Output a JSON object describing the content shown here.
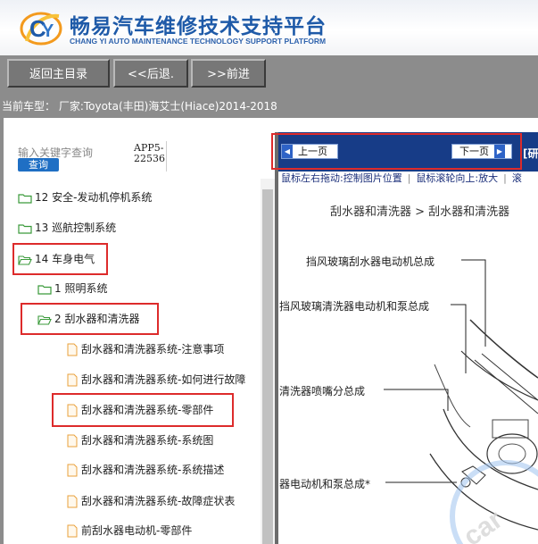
{
  "header": {
    "title": "畅易汽车维修技术支持平台",
    "subtitle": "CHANG YI AUTO MAINTENANCE TECHNOLOGY SUPPORT PLATFORM",
    "logo_icon": "cy-logo-icon"
  },
  "toolbar": {
    "home_label": "返回主目录",
    "back_label": "<<后退.",
    "forward_label": ">>前进"
  },
  "model_bar": {
    "text": "当前车型：  厂家:Toyota(丰田)海艾士(Hiace)2014-2018"
  },
  "search": {
    "placeholder": "输入关键字查询",
    "button_label": "查询",
    "app_code_line1": "APP5-",
    "app_code_line2": "22536"
  },
  "tree": {
    "items": [
      {
        "label": "12 安全-发动机停机系统",
        "icon": "folder-icon"
      },
      {
        "label": "13 巡航控制系统",
        "icon": "folder-icon"
      },
      {
        "label": "14 车身电气",
        "icon": "folder-open-icon"
      },
      {
        "label": "1 照明系统",
        "icon": "folder-icon"
      },
      {
        "label": "2 刮水器和清洗器",
        "icon": "folder-open-icon"
      },
      {
        "label": "刮水器和清洗器系统-注意事项",
        "icon": "document-icon"
      },
      {
        "label": "刮水器和清洗器系统-如何进行故障",
        "icon": "document-icon"
      },
      {
        "label": "刮水器和清洗器系统-零部件",
        "icon": "document-icon"
      },
      {
        "label": "刮水器和清洗器系统-系统图",
        "icon": "document-icon"
      },
      {
        "label": "刮水器和清洗器系统-系统描述",
        "icon": "document-icon"
      },
      {
        "label": "刮水器和清洗器系统-故障症状表",
        "icon": "document-icon"
      },
      {
        "label": "前刮水器电动机-零部件",
        "icon": "document-icon"
      }
    ]
  },
  "viewer": {
    "prev_label": "上一页",
    "next_label": "下一页",
    "side_label": "[研",
    "hint_drag": "鼠标左右拖动:控制图片位置",
    "hint_scroll": "鼠标滚轮向上:放大",
    "hint_more": "滚",
    "diagram": {
      "title": "刮水器和清洗器 > 刮水器和清洗器",
      "labels": [
        "挡风玻璃刮水器电动机总成",
        "挡风玻璃清洗器电动机和泵总成",
        "清洗器喷嘴分总成",
        "器电动机和泵总成*"
      ]
    }
  },
  "colors": {
    "highlight": "#dd2b2b",
    "viewer_bar": "#173c87",
    "toolbar_bg": "#8c8c8c",
    "brand_blue": "#1e5aa8"
  }
}
